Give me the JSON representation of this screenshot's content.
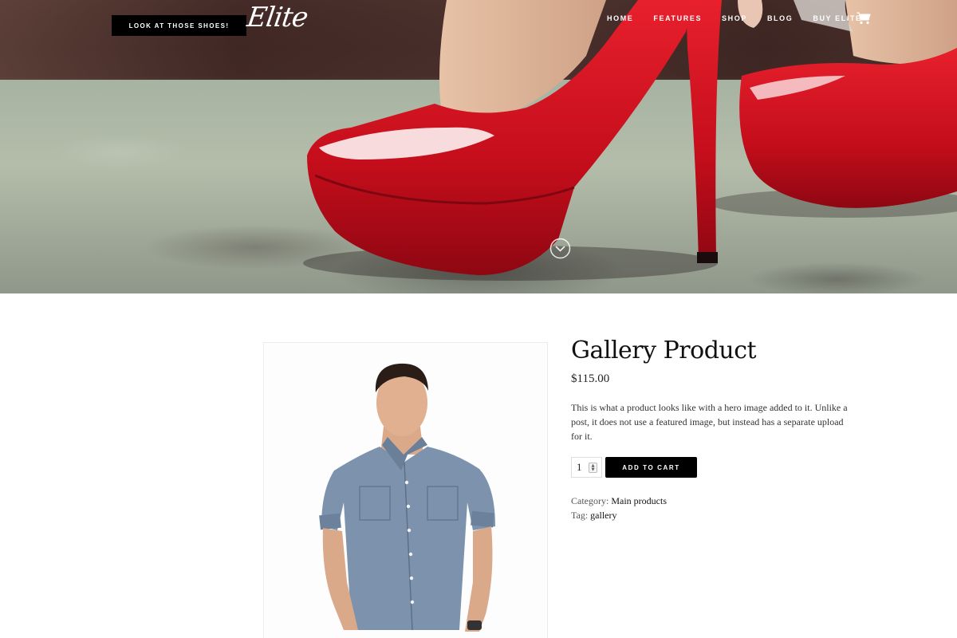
{
  "header": {
    "cta_label": "LOOK AT THOSE SHOES!",
    "logo_text": "Elite",
    "nav": [
      {
        "label": "HOME"
      },
      {
        "label": "FEATURES"
      },
      {
        "label": "SHOP"
      },
      {
        "label": "BLOG"
      },
      {
        "label": "BUY ELITE"
      }
    ],
    "cart_icon": "shopping-cart-icon"
  },
  "hero": {
    "image": "red-high-heels-photo",
    "scroll_icon": "chevron-down-circle-icon"
  },
  "product": {
    "image": "man-in-denim-shirt-photo",
    "title": "Gallery Product",
    "price": "$115.00",
    "description": "This is what a product looks like with a hero image added to it. Unlike a post, it does not use a featured image, but instead has a separate upload for it.",
    "quantity": "1",
    "add_to_cart_label": "ADD TO CART",
    "category_label": "Category:",
    "category_value": "Main products",
    "tag_label": "Tag:",
    "tag_value": "gallery"
  },
  "colors": {
    "accent": "#000000",
    "shoe_red": "#d6101e",
    "background": "#ffffff"
  }
}
